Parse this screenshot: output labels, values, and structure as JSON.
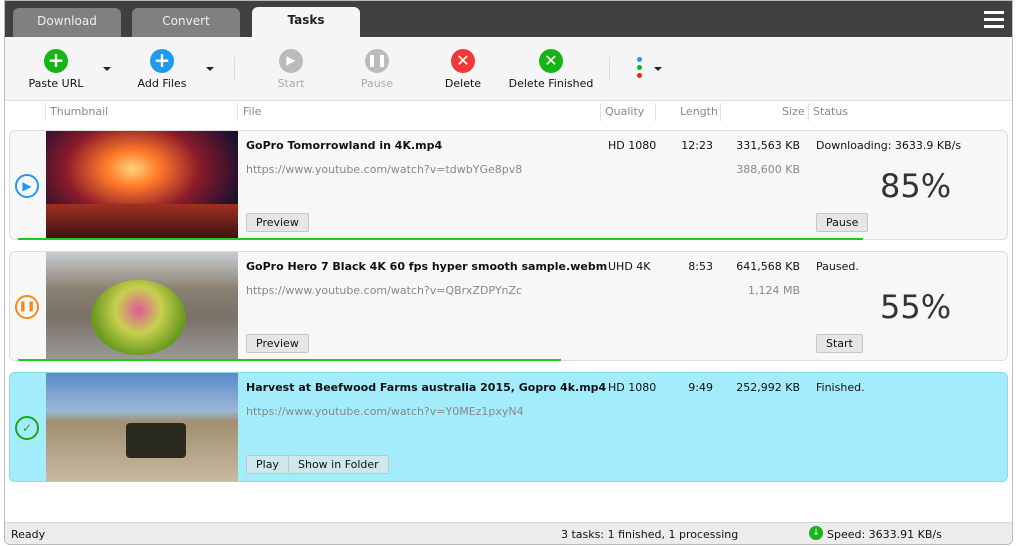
{
  "tabs": [
    {
      "label": "Download"
    },
    {
      "label": "Convert"
    },
    {
      "label": "Tasks"
    }
  ],
  "active_tab": "Tasks",
  "toolbar": {
    "paste_url": "Paste URL",
    "add_files": "Add Files",
    "start": "Start",
    "pause": "Pause",
    "delete": "Delete",
    "delete_finished": "Delete Finished"
  },
  "columns": {
    "thumbnail": "Thumbnail",
    "file": "File",
    "quality": "Quality",
    "length": "Length",
    "size": "Size",
    "status": "Status"
  },
  "tasks": [
    {
      "name": "GoPro  Tomorrowland in 4K.mp4",
      "url": "https://www.youtube.com/watch?v=tdwbYGe8pv8",
      "quality": "HD 1080",
      "length": "12:23",
      "size": "331,563 KB",
      "total": "388,600 KB",
      "status": "Downloading: 3633.9 KB/s",
      "percent": "85%",
      "progress": 85,
      "state": "downloading",
      "buttons": [
        "Preview"
      ],
      "action": "Pause"
    },
    {
      "name": "GoPro Hero 7 Black 4K 60 fps hyper smooth sample.webm",
      "url": "https://www.youtube.com/watch?v=QBrxZDPYnZc",
      "quality": "UHD 4K",
      "length": "8:53",
      "size": "641,568 KB",
      "total": "1,124 MB",
      "status": "Paused.",
      "percent": "55%",
      "progress": 55,
      "state": "paused",
      "buttons": [
        "Preview"
      ],
      "action": "Start"
    },
    {
      "name": "Harvest at Beefwood Farms australia 2015, Gopro 4k.mp4",
      "url": "https://www.youtube.com/watch?v=Y0MEz1pxyN4",
      "quality": "HD 1080",
      "length": "9:49",
      "size": "252,992 KB",
      "status": "Finished.",
      "state": "finished",
      "buttons": [
        "Play",
        "Show in Folder"
      ]
    }
  ],
  "statusbar": {
    "ready": "Ready",
    "summary": "3 tasks: 1 finished, 1 processing",
    "speed": "Speed: 3633.91 KB/s"
  },
  "colors": {
    "accent_green": "#1ccc1c",
    "selected_row": "#a3ecfc",
    "add_blue": "#1e9bf0",
    "delete_red": "#f03a3a"
  }
}
